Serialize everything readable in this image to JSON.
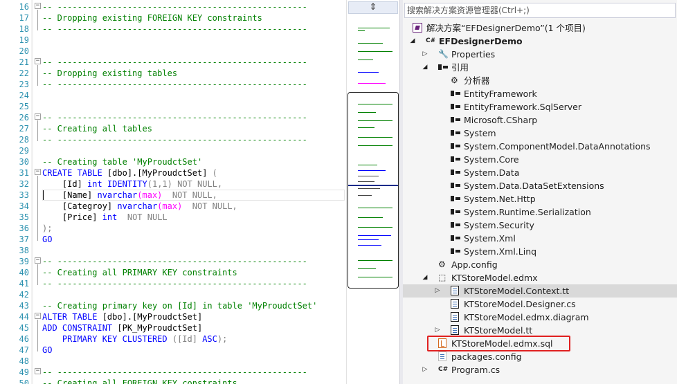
{
  "editor": {
    "line_numbers": [
      "16",
      "17",
      "18",
      "19",
      "20",
      "21",
      "22",
      "23",
      "24",
      "25",
      "26",
      "27",
      "28",
      "29",
      "30",
      "31",
      "32",
      "33",
      "34",
      "35",
      "36",
      "37",
      "38",
      "39",
      "40",
      "41",
      "42",
      "43",
      "44",
      "45",
      "46",
      "47",
      "48",
      "49",
      "50"
    ],
    "lines": {
      "l16": "-- --------------------------------------------------",
      "l17": "-- Dropping existing FOREIGN KEY constraints",
      "l18": "-- --------------------------------------------------",
      "l21": "-- --------------------------------------------------",
      "l22": "-- Dropping existing tables",
      "l23": "-- --------------------------------------------------",
      "l26": "-- --------------------------------------------------",
      "l27": "-- Creating all tables",
      "l28": "-- --------------------------------------------------",
      "l30": "-- Creating table 'MyProudctSet'",
      "l31_kw": "CREATE TABLE",
      "l31_rest": " [dbo].[MyProudctSet] ",
      "l31_paren": "(",
      "l32_a": "    [Id] ",
      "l32_int": "int",
      "l32_ident": "IDENTITY",
      "l32_args": "(1,1) ",
      "l32_nn": "NOT NULL,",
      "l33_a": "    [Name] ",
      "l33_type": "nvarchar",
      "l33_max": "(max)",
      "l33_nn": "  NOT NULL,",
      "l34_a": "    [Categroy] ",
      "l34_type": "nvarchar",
      "l34_max": "(max)",
      "l34_nn": "  NOT NULL,",
      "l35_a": "    [Price] ",
      "l35_int": "int",
      "l35_nn": "  NOT NULL",
      "l36": ");",
      "l37": "GO",
      "l39": "-- --------------------------------------------------",
      "l40": "-- Creating all PRIMARY KEY constraints",
      "l41": "-- --------------------------------------------------",
      "l43": "-- Creating primary key on [Id] in table 'MyProudctSet'",
      "l44_kw": "ALTER TABLE",
      "l44_rest": " [dbo].[MyProudctSet]",
      "l45_kw": "ADD CONSTRAINT",
      "l45_rest": " [PK_MyProudctSet]",
      "l46_kw": "    PRIMARY KEY CLUSTERED",
      "l46_rest": " ([Id] ",
      "l46_asc": "ASC",
      "l46_end": ");",
      "l47": "GO",
      "l49": "-- --------------------------------------------------",
      "l50": "-- Creating all FOREIGN KEY constraints"
    }
  },
  "minimap": {
    "split_glyph": "⇕"
  },
  "explorer": {
    "search_placeholder": "搜索解决方案资源管理器(Ctrl+;)",
    "solution": "解决方案“EFDesignerDemo”(1 个项目)",
    "project": "EFDesignerDemo",
    "project_badge": "C#",
    "properties": "Properties",
    "references": "引用",
    "analyzer": "分析器",
    "refs": [
      "EntityFramework",
      "EntityFramework.SqlServer",
      "Microsoft.CSharp",
      "System",
      "System.ComponentModel.DataAnnotations",
      "System.Core",
      "System.Data",
      "System.Data.DataSetExtensions",
      "System.Net.Http",
      "System.Runtime.Serialization",
      "System.Security",
      "System.Xml",
      "System.Xml.Linq"
    ],
    "app_config": "App.config",
    "edmx": "KTStoreModel.edmx",
    "context_tt": "KTStoreModel.Context.tt",
    "designer_cs": "KTStoreModel.Designer.cs",
    "diagram": "KTStoreModel.edmx.diagram",
    "model_tt": "KTStoreModel.tt",
    "edmx_sql": "KTStoreModel.edmx.sql",
    "packages_config": "packages.config",
    "program_cs": "Program.cs",
    "program_badge": "C#"
  },
  "colors": {
    "comment": "#008000",
    "keyword": "#0000ff",
    "function": "#ff00ff",
    "line_number": "#2b91af",
    "highlight_box": "#e02020"
  }
}
